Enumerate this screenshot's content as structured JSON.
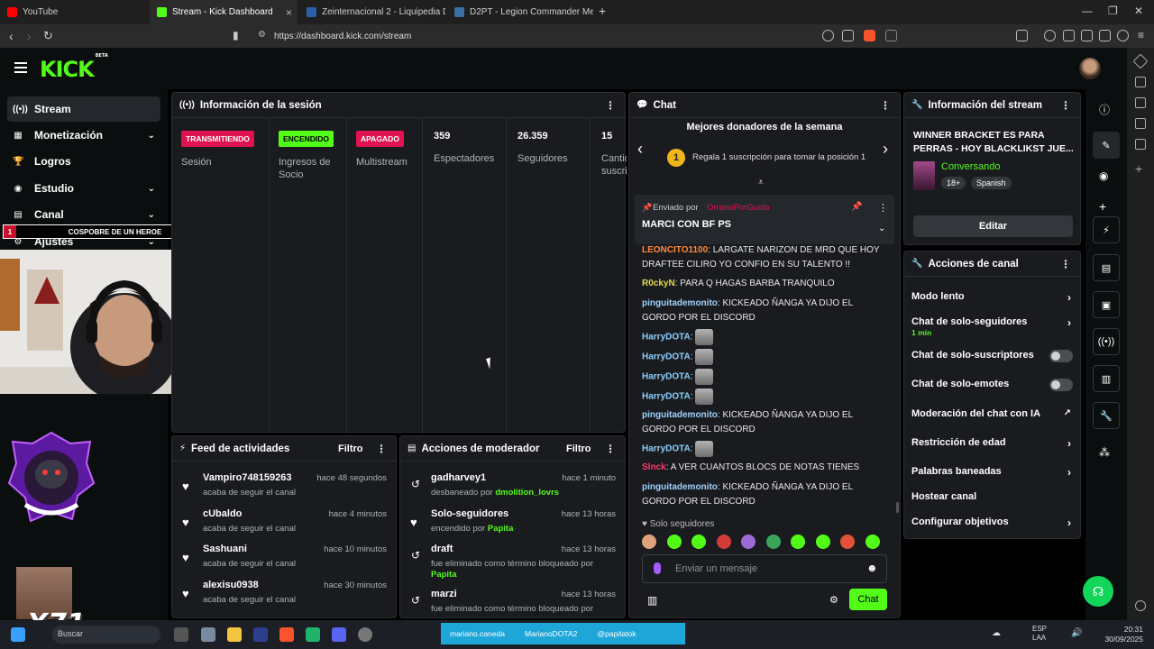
{
  "browser": {
    "tabs": [
      {
        "label": "YouTube",
        "color": "#ff0000"
      },
      {
        "label": "Stream - Kick Dashboard",
        "color": "#53fc18"
      },
      {
        "label": "Zeinternacional 2 - Liquipedia Dota 2",
        "color": "#2b5fa8"
      },
      {
        "label": "D2PT - Legion Commander Meta Item",
        "color": "#3a6ea5"
      }
    ],
    "url": "https://dashboard.kick.com/stream"
  },
  "kick": {
    "logo": "KICK",
    "logo_sup": "BETA",
    "nav": [
      {
        "label": "Stream",
        "icon": "stream-icon",
        "glyph": "((•))",
        "active": true,
        "chevron": false
      },
      {
        "label": "Monetización",
        "icon": "monetization-icon",
        "glyph": "▦",
        "active": false,
        "chevron": true
      },
      {
        "label": "Logros",
        "icon": "trophy-icon",
        "glyph": "🏆",
        "active": false,
        "chevron": false
      },
      {
        "label": "Estudio",
        "icon": "studio-icon",
        "glyph": "◉",
        "active": false,
        "chevron": true
      },
      {
        "label": "Canal",
        "icon": "channel-icon",
        "glyph": "▤",
        "active": false,
        "chevron": true
      },
      {
        "label": "Ajustes",
        "icon": "settings-icon",
        "glyph": "⚙",
        "active": false,
        "chevron": true
      }
    ]
  },
  "overlay": {
    "cosplay_num": "1",
    "cosplay_text": "COSPOBRE DE UN HEROE",
    "cosplay_count": "10",
    "brand": "X71"
  },
  "session": {
    "title": "Información de la sesión",
    "badges": [
      {
        "badge": "TRANSMITIENDO",
        "label": "Sesión",
        "bg": "#e0124f",
        "fg": "#ffffff"
      },
      {
        "badge": "ENCENDIDO",
        "label": "Ingresos de Socio",
        "bg": "#53fc18",
        "fg": "#000000"
      },
      {
        "badge": "APAGADO",
        "label": "Multistream",
        "bg": "#e0124f",
        "fg": "#ffffff"
      }
    ],
    "stats": [
      {
        "value": "359",
        "label": "Espectadores"
      },
      {
        "value": "26.359",
        "label": "Seguidores"
      },
      {
        "value": "15",
        "label": "Cantidad de suscriptores"
      }
    ]
  },
  "feed": {
    "title": "Feed de actividades",
    "filter": "Filtro",
    "items": [
      {
        "name": "Vampiro748159263",
        "sub": "acaba de seguir el canal",
        "time": "hace 48 segundos"
      },
      {
        "name": "cUbaldo",
        "sub": "acaba de seguir el canal",
        "time": "hace 4 minutos"
      },
      {
        "name": "Sashuani",
        "sub": "acaba de seguir el canal",
        "time": "hace 10 minutos"
      },
      {
        "name": "alexisu0938",
        "sub": "acaba de seguir el canal",
        "time": "hace 30 minutos"
      }
    ]
  },
  "mod": {
    "title": "Acciones de moderador",
    "filter": "Filtro",
    "items": [
      {
        "icon": "undo-icon",
        "name": "gadharvey1",
        "sub": "desbaneado por ",
        "by": "dmolition_lovrs",
        "time": "hace 1 minuto"
      },
      {
        "icon": "heart-icon",
        "name": "Solo-seguidores",
        "sub": "encendido por ",
        "by": "Papita",
        "time": "hace 13 horas"
      },
      {
        "icon": "undo-icon",
        "name": "draft",
        "sub": "fue eliminado como término bloqueado por ",
        "by": "Papita",
        "time": "hace 13 horas"
      },
      {
        "icon": "undo-icon",
        "name": "marzi",
        "sub": "fue eliminado como término bloqueado por",
        "by": "",
        "time": "hace 13 horas"
      }
    ]
  },
  "chat": {
    "title": "Chat",
    "donors_title": "Mejores donadores de la semana",
    "donors_rank": "1",
    "donors_text": "Regala 1 suscripción para tomar la posición 1",
    "pinned_by": "Enviado por",
    "pinned_user": "OrranoPorGusto",
    "pinned_msg": "MARCI CON BF PS",
    "messages": [
      {
        "user": "LEONCITO1100",
        "color": "#ff8a3d",
        "text": "LARGATE NARIZON DE MRD QUE HOY DRAFTEE CILIRO YO CONFIO EN SU TALENTO !!",
        "emote": false
      },
      {
        "user": "R0ckyN",
        "color": "#e7d64a",
        "text": "PARA Q HAGAS BARBA TRANQUILO",
        "emote": false
      },
      {
        "user": "pinguitademonito",
        "color": "#9fd3ff",
        "text": "KICKEADO ÑANGA YA DIJO EL GORDO POR EL DISCORD",
        "emote": false
      },
      {
        "user": "HarryDOTA",
        "color": "#8ad0ff",
        "text": "",
        "emote": true
      },
      {
        "user": "HarryDOTA",
        "color": "#8ad0ff",
        "text": "",
        "emote": true
      },
      {
        "user": "HarryDOTA",
        "color": "#8ad0ff",
        "text": "",
        "emote": true
      },
      {
        "user": "HarryDOTA",
        "color": "#8ad0ff",
        "text": "",
        "emote": true
      },
      {
        "user": "pinguitademonito",
        "color": "#9fd3ff",
        "text": "KICKEADO ÑANGA YA DIJO EL GORDO POR EL DISCORD",
        "emote": false
      },
      {
        "user": "HarryDOTA",
        "color": "#8ad0ff",
        "text": "",
        "emote": true
      },
      {
        "user": "Slnck",
        "color": "#ff3b6b",
        "text": "A VER CUANTOS BLOCS DE NOTAS TIENES",
        "emote": false
      },
      {
        "user": "pinguitademonito",
        "color": "#9fd3ff",
        "text": "KICKEADO ÑANGA YA DIJO EL GORDO POR EL DISCORD",
        "emote": false
      }
    ],
    "followers_only": "Solo seguidores",
    "placeholder": "Enviar un mensaje",
    "send": "Chat"
  },
  "stream_info": {
    "title": "Información del stream",
    "stream_title": "WINNER BRACKET ES PARA PERRAS - HOY BLACKLIKST JUE...",
    "category": "Conversando",
    "tags": [
      "18+",
      "Spanish"
    ],
    "edit": "Editar"
  },
  "channel_actions": {
    "title": "Acciones de canal",
    "items": [
      {
        "label": "Modo lento",
        "type": "chevron",
        "sub": ""
      },
      {
        "label": "Chat de solo-seguidores",
        "type": "chevron",
        "sub": "1 min"
      },
      {
        "label": "Chat de solo-suscriptores",
        "type": "toggle",
        "sub": ""
      },
      {
        "label": "Chat de solo-emotes",
        "type": "toggle",
        "sub": ""
      },
      {
        "label": "Moderación del chat con IA",
        "type": "external",
        "sub": ""
      },
      {
        "label": "Restricción de edad",
        "type": "chevron",
        "sub": ""
      },
      {
        "label": "Palabras baneadas",
        "type": "chevron",
        "sub": ""
      },
      {
        "label": "Hostear canal",
        "type": "none",
        "sub": ""
      },
      {
        "label": "Configurar objetivos",
        "type": "chevron",
        "sub": ""
      }
    ]
  },
  "taskbar": {
    "search": "Buscar",
    "social": [
      "mariano.caneda",
      "MarianoDOTA2",
      "@papitatok"
    ],
    "lang": "ESP",
    "lang2": "LAA",
    "time": "20:31",
    "date": "30/09/2025"
  }
}
